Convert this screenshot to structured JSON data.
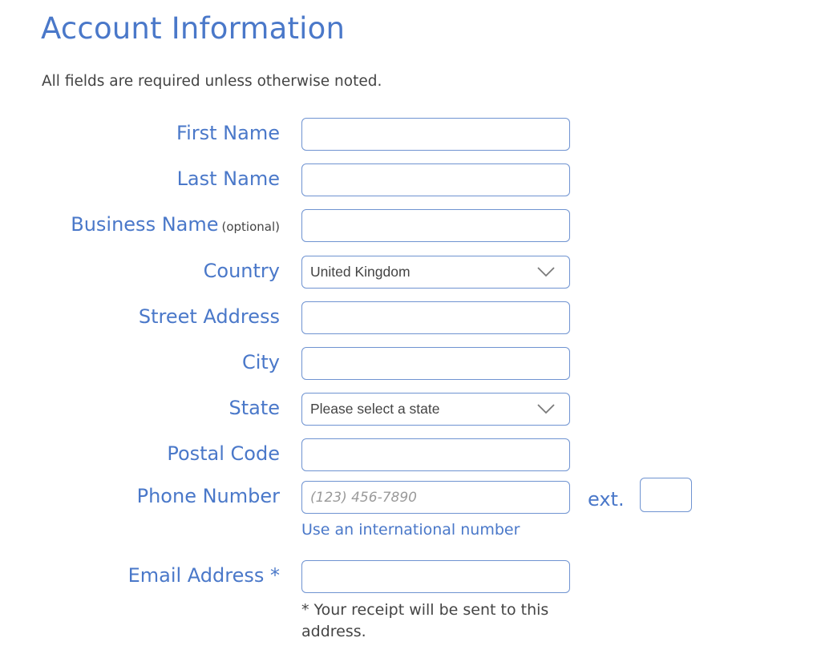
{
  "header": {
    "title": "Account Information",
    "subtitle": "All fields are required unless otherwise noted."
  },
  "form": {
    "first_name": {
      "label": "First Name",
      "value": "",
      "placeholder": ""
    },
    "last_name": {
      "label": "Last Name",
      "value": "",
      "placeholder": ""
    },
    "business_name": {
      "label": "Business Name",
      "optional_note": "(optional)",
      "value": "",
      "placeholder": ""
    },
    "country": {
      "label": "Country",
      "selected": "United Kingdom",
      "icon": "chevron-down-icon"
    },
    "street_address": {
      "label": "Street Address",
      "value": "",
      "placeholder": ""
    },
    "city": {
      "label": "City",
      "value": "",
      "placeholder": ""
    },
    "state": {
      "label": "State",
      "selected": "Please select a state",
      "icon": "chevron-down-icon"
    },
    "postal_code": {
      "label": "Postal Code",
      "value": "",
      "placeholder": ""
    },
    "phone": {
      "label": "Phone Number",
      "value": "",
      "placeholder": "(123) 456-7890",
      "ext_label": "ext.",
      "ext_value": "",
      "international_link": "Use an international number"
    },
    "email": {
      "label": "Email Address *",
      "value": "",
      "placeholder": "",
      "note": "* Your receipt will be sent to this address."
    }
  },
  "colors": {
    "accent": "#4a78c9",
    "border": "#6f93d1",
    "text": "#444444"
  }
}
